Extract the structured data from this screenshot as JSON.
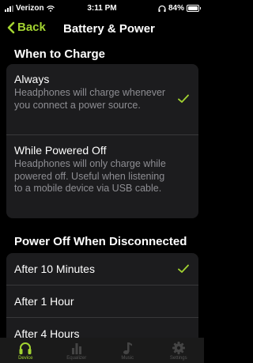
{
  "status_bar": {
    "carrier": "Verizon",
    "time": "3:11 PM",
    "battery": "84%"
  },
  "nav": {
    "back_label": "Back",
    "title": "Battery & Power"
  },
  "charge_section": {
    "title": "When to Charge",
    "options": [
      {
        "title": "Always",
        "description": "Headphones will charge whenever you connect a power source.",
        "selected": true
      },
      {
        "title": "While Powered Off",
        "description": "Headphones will only charge while powered off. Useful when listening to a mobile device via USB cable.",
        "selected": false
      }
    ]
  },
  "power_off_section": {
    "title": "Power Off When Disconnected",
    "options": [
      {
        "title": "After 10 Minutes",
        "selected": true
      },
      {
        "title": "After 1 Hour",
        "selected": false
      },
      {
        "title": "After 4 Hours",
        "selected": false
      }
    ]
  },
  "tabs": [
    {
      "label": "Device",
      "icon": "headphones-icon",
      "active": true
    },
    {
      "label": "Equalizer",
      "icon": "equalizer-icon",
      "active": false
    },
    {
      "label": "Music",
      "icon": "music-note-icon",
      "active": false
    },
    {
      "label": "Settings",
      "icon": "gear-icon",
      "active": false
    }
  ],
  "colors": {
    "accent": "#a3d431",
    "background": "#000000",
    "card": "#1c1c1e",
    "secondary_text": "#8e8e93"
  }
}
